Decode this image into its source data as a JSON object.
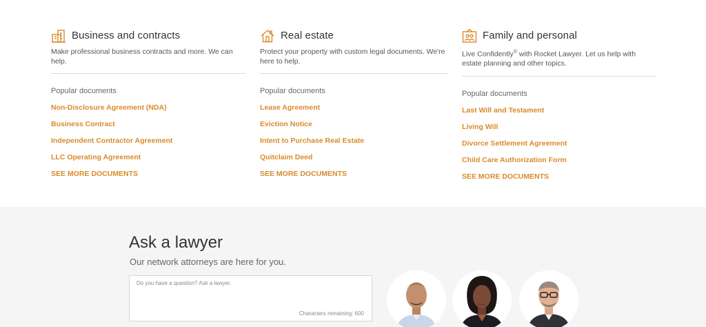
{
  "colors": {
    "accent": "#d98a2b",
    "panel_bg": "#f5f5f5"
  },
  "categories": [
    {
      "icon": "business-building-icon",
      "title": "Business and contracts",
      "description": "Make professional business contracts and more. We can help.",
      "popular_label": "Popular documents",
      "documents": [
        "Non-Disclosure Agreement (NDA)",
        "Business Contract",
        "Independent Contractor Agreement",
        "LLC Operating Agreement"
      ],
      "more_label": "SEE MORE DOCUMENTS"
    },
    {
      "icon": "house-icon",
      "title": "Real estate",
      "description": "Protect your property with custom legal documents. We're here to help.",
      "popular_label": "Popular documents",
      "documents": [
        "Lease Agreement",
        "Eviction Notice",
        "Intent to Purchase Real Estate",
        "Quitclaim Deed"
      ],
      "more_label": "SEE MORE DOCUMENTS"
    },
    {
      "icon": "family-portrait-icon",
      "title": "Family and personal",
      "description_pre": "Live Confidently",
      "description_sup": "®",
      "description_post": " with Rocket Lawyer. Let us help with estate planning and other topics.",
      "popular_label": "Popular documents",
      "documents": [
        "Last Will and Testament",
        "Living Will",
        "Divorce Settlement Agreement",
        "Child Care Authorization Form"
      ],
      "more_label": "SEE MORE DOCUMENTS"
    }
  ],
  "ask": {
    "title": "Ask a lawyer",
    "subtitle": "Our network attorneys are here for you.",
    "placeholder": "Do you have a question? Ask a lawyer.",
    "chars_remaining": "Characters remaining: 600"
  },
  "attorneys": [
    {
      "icon": "attorney-photo-1"
    },
    {
      "icon": "attorney-photo-2"
    },
    {
      "icon": "attorney-photo-3"
    }
  ]
}
